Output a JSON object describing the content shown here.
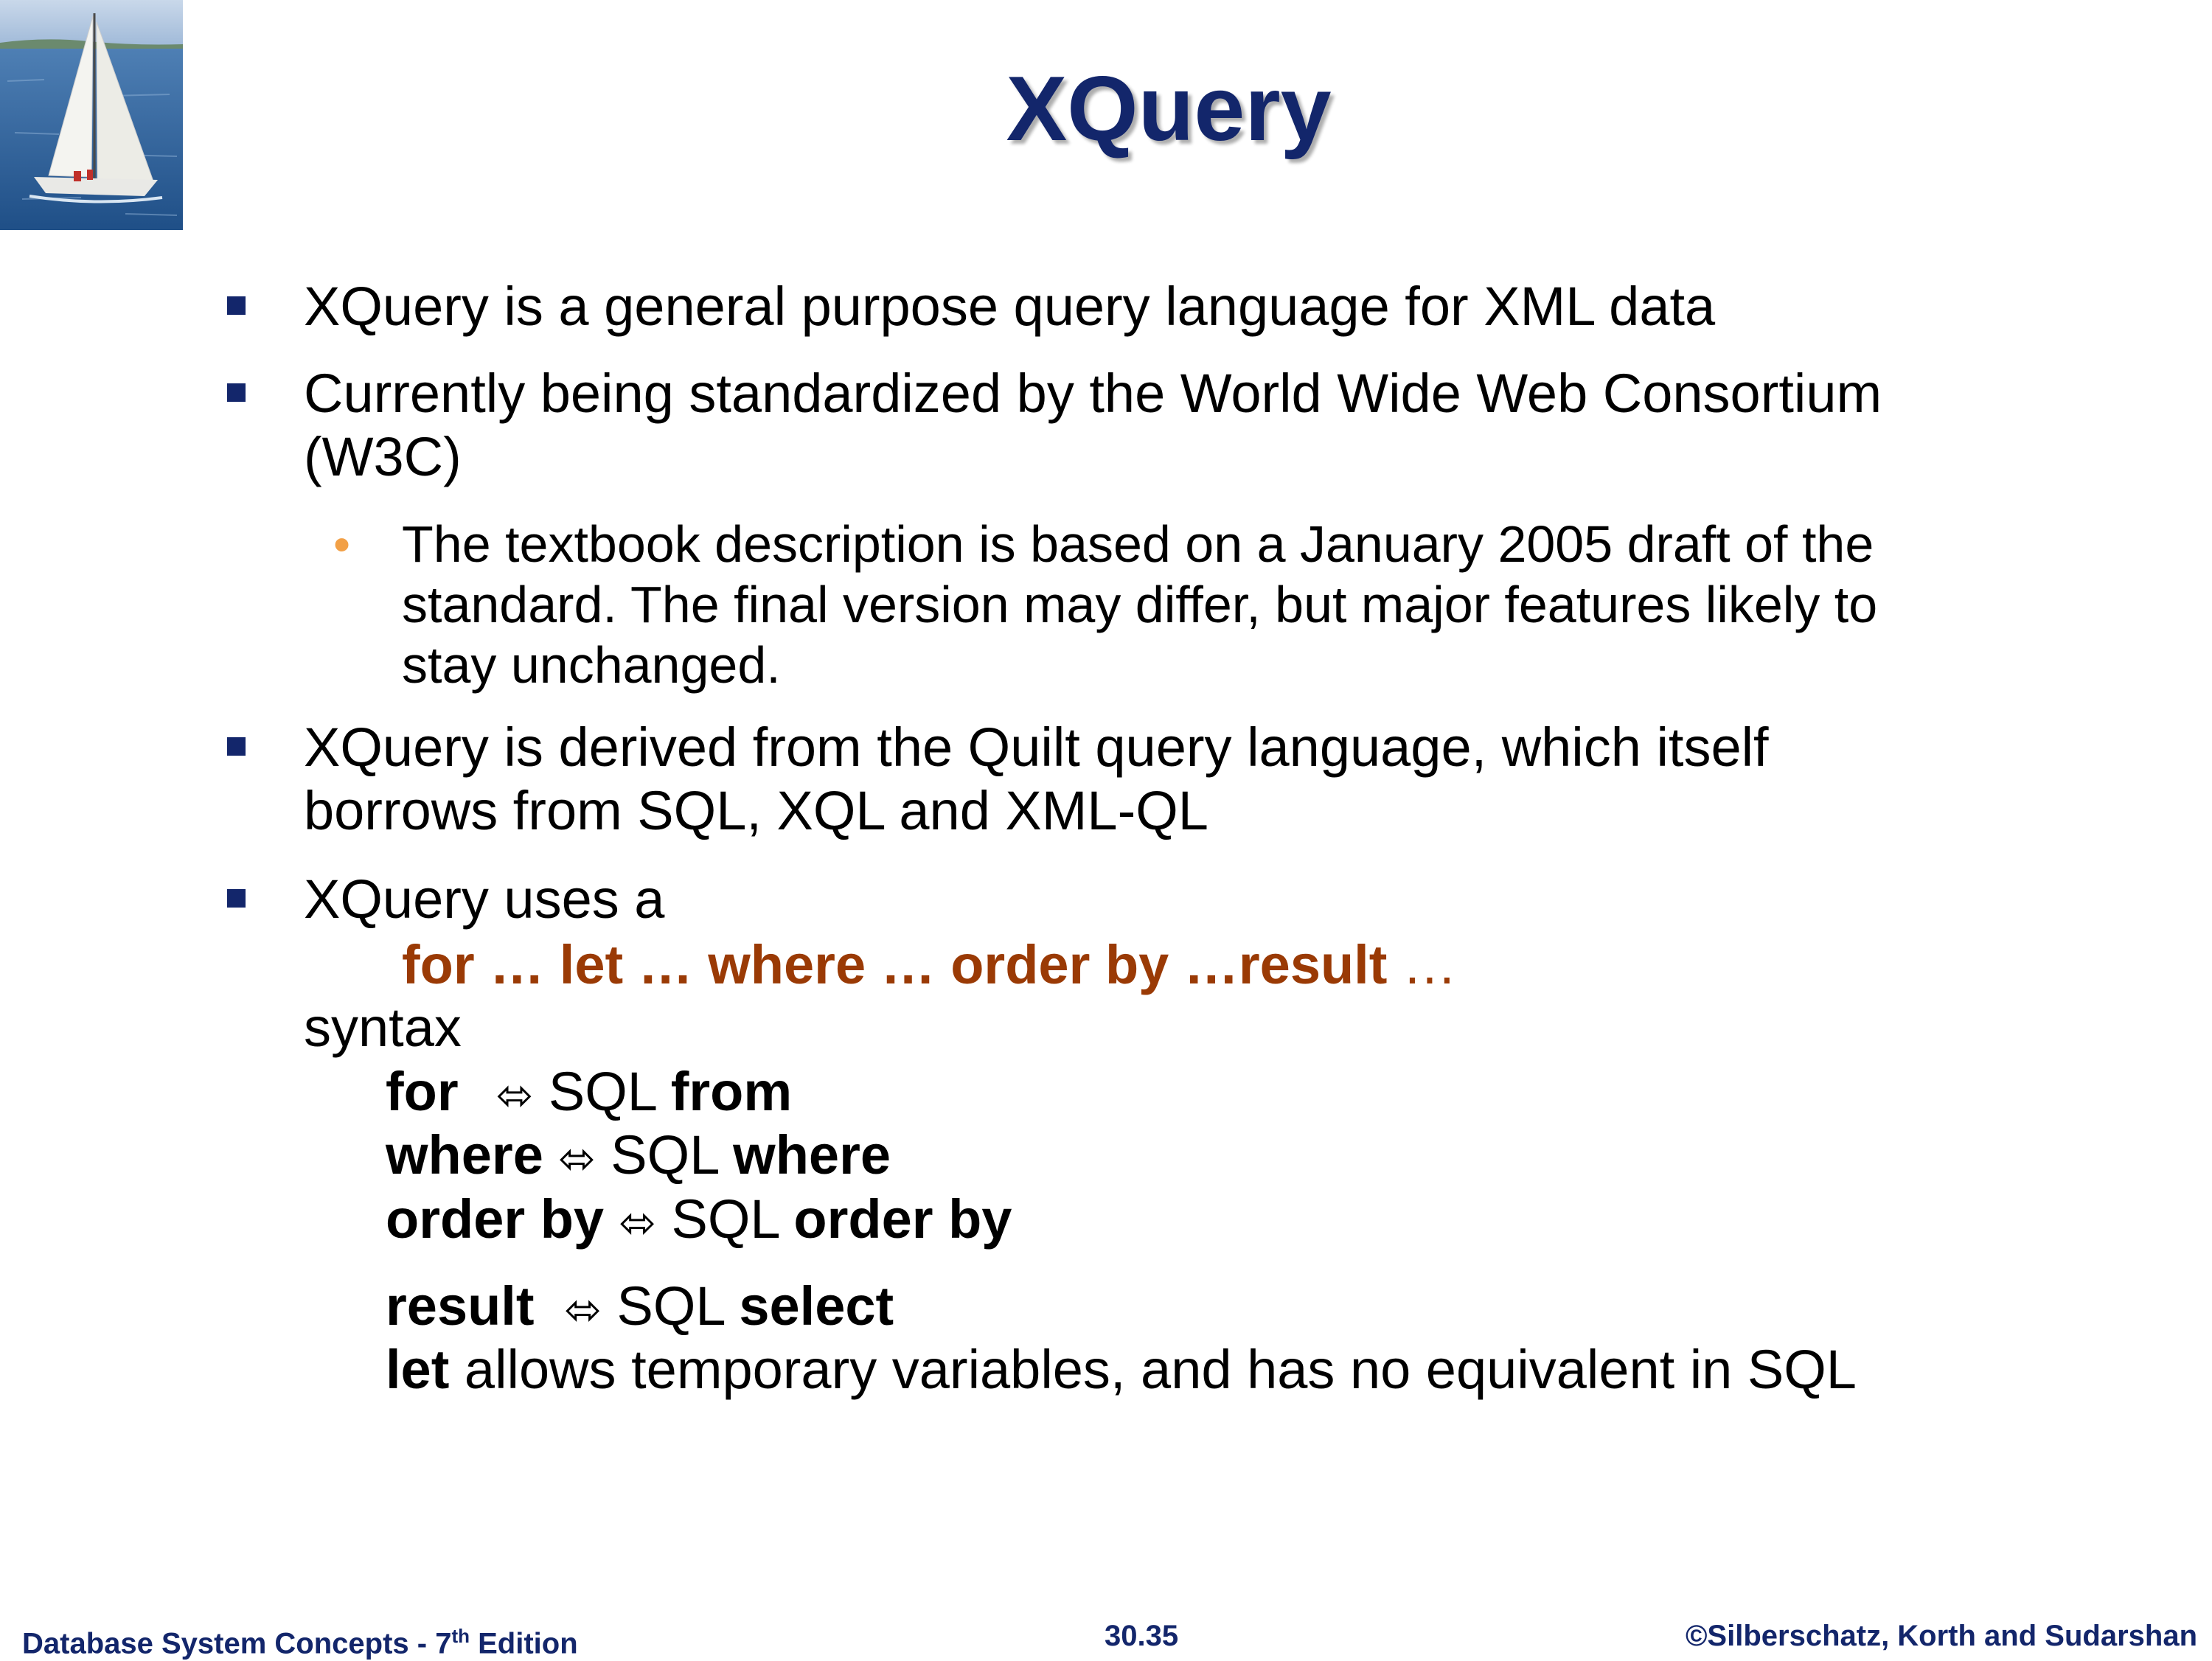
{
  "slide": {
    "title": "XQuery",
    "bullets": [
      "XQuery is a general purpose query language for XML data",
      [
        "Currently being standardized by the World Wide Web Consortium",
        "(W3C)"
      ],
      [
        "XQuery is derived from the Quilt query language, which itself",
        "borrows from SQL, XQL and XML-QL"
      ],
      "XQuery uses a"
    ],
    "sub_bullet": [
      "The textbook description is based on a January 2005 draft of the",
      "standard.  The final version may differ, but major features likely to",
      "stay unchanged."
    ],
    "syntax_line": {
      "keywords": "for … let … where … order by …result",
      "trailing": " …"
    },
    "syntax_word": "syntax",
    "mappings": [
      {
        "left": "for",
        "arrow": "⬄",
        "sql": "SQL",
        "right": "from"
      },
      {
        "left": "where",
        "arrow": "⬄",
        "sql": "SQL",
        "right": "where"
      },
      {
        "left": "order by",
        "arrow": "⬄",
        "sql": "SQL",
        "right": "order by"
      },
      {
        "left": "result",
        "arrow": "⬄",
        "sql": "SQL",
        "right": "select"
      }
    ],
    "let_line": {
      "keyword": "let",
      "rest": " allows temporary variables, and has no equivalent in SQL"
    }
  },
  "footer": {
    "left_prefix": "Database System Concepts - 7",
    "left_sup": "th",
    "left_suffix": " Edition",
    "center": "30.35",
    "right": "©Silberschatz, Korth and Sudarshan"
  },
  "colors": {
    "title": "#13266b",
    "bullet_square": "#13266b",
    "sub_bullet_dot": "#f2a046",
    "syntax_keywords": "#9a3a05",
    "footer": "#13266b"
  },
  "icons": {
    "logo": "sailboat-logo",
    "bullet": "square-bullet-icon",
    "sub_bullet": "round-bullet-icon",
    "mapping_arrow": "double-arrow-icon"
  }
}
